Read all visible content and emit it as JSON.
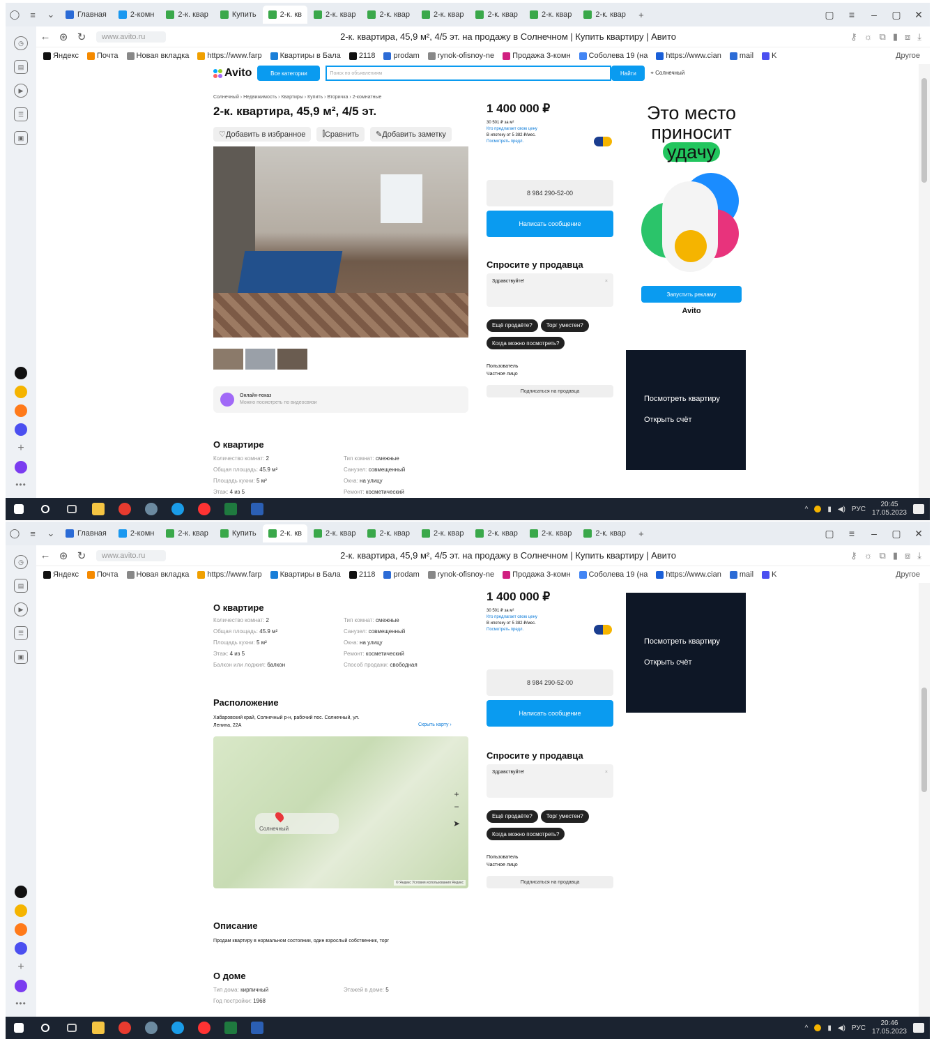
{
  "browser": {
    "tabs": [
      {
        "label": "Главная",
        "color": "#2b6bd6"
      },
      {
        "label": "2-комн",
        "color": "#1a98f0"
      },
      {
        "label": "2-к. квар",
        "color": "#3aa84a"
      },
      {
        "label": "Купить",
        "color": "#3aa84a"
      },
      {
        "label": "2-к. кв",
        "color": "#3aa84a"
      },
      {
        "label": "2-к. квар",
        "color": "#3aa84a"
      },
      {
        "label": "2-к. квар",
        "color": "#3aa84a"
      },
      {
        "label": "2-к. квар",
        "color": "#3aa84a"
      },
      {
        "label": "2-к. квар",
        "color": "#3aa84a"
      },
      {
        "label": "2-к. квар",
        "color": "#3aa84a"
      },
      {
        "label": "2-к. квар",
        "color": "#3aa84a"
      }
    ],
    "active_tab": 4,
    "url": "www.avito.ru",
    "page_title": "2-к. квартира, 45,9 м², 4/5 эт. на продажу в Солнечном | Купить квартиру | Авито",
    "bookmarks": [
      "Яндекс",
      "Почта",
      "Новая вкладка",
      "https://www.farp",
      "Квартиры в Бала",
      "2118",
      "prodam",
      "rynok-ofisnoy-ne",
      "Продажа 3-комн",
      "Соболева 19 (на",
      "https://www.cian",
      "mail",
      "K"
    ],
    "bookmarks_other": "Другое"
  },
  "avito": {
    "logo": "Avito",
    "all_categories": "Все категории",
    "search_placeholder": "Поиск по объявлениям",
    "search_button": "Найти",
    "city": "Солнечный",
    "breadcrumb": "Солнечный › Недвижимость › Квартиры › Купить › Вторичка › 2-комнатные",
    "listing_title": "2-к. квартира, 45,9 м², 4/5 эт.",
    "actions": [
      "Добавить в избранное",
      "Сравнить",
      "Добавить заметку"
    ],
    "online_show_title": "Онлайн-показ",
    "online_show_sub": "Можно посмотреть по видеосвязи",
    "price": "1 400 000 ₽",
    "price_per_m2": "30 501 ₽ за м²",
    "price_history": "Кто предлагает свою цену",
    "mortgage": "В ипотеку от 5 382 ₽/мес.",
    "mortgage_link": "Посмотреть предл.",
    "phone": "8 984 290-52-00",
    "write_button": "Написать сообщение",
    "ask_title": "Спросите у продавца",
    "ask_placeholder": "Здравствуйте!",
    "quick_questions": [
      "Ещё продаёте?",
      "Торг уместен?",
      "Когда можно посмотреть?"
    ],
    "seller_role": "Пользователь",
    "seller_type": "Частное лицо",
    "subscribe": "Подписаться на продавца",
    "ad_text_1": "Это место",
    "ad_text_2": "приносит",
    "ad_text_3": "удачу",
    "ad_button": "Запустить рекламу",
    "ad_logo": "Avito",
    "video_label_1": "Посмотреть квартиру",
    "video_label_2": "Открыть счёт",
    "about_flat_title": "О квартире",
    "about_flat": [
      {
        "k": "Количество комнат:",
        "v": "2"
      },
      {
        "k": "Общая площадь:",
        "v": "45.9 м²"
      },
      {
        "k": "Площадь кухни:",
        "v": "5 м²"
      },
      {
        "k": "Этаж:",
        "v": "4 из 5"
      },
      {
        "k": "Балкон или лоджия:",
        "v": "балкон"
      }
    ],
    "about_flat_right": [
      {
        "k": "Тип комнат:",
        "v": "смежные"
      },
      {
        "k": "Санузел:",
        "v": "совмещенный"
      },
      {
        "k": "Окна:",
        "v": "на улицу"
      },
      {
        "k": "Ремонт:",
        "v": "косметический"
      },
      {
        "k": "Способ продажи:",
        "v": "свободная"
      }
    ],
    "location_title": "Расположение",
    "address_line1": "Хабаровский край, Солнечный р-н, рабочий пос. Солнечный, ул.",
    "address_line2": "Ленина, 22А",
    "show_map": "Скрыть карту",
    "map_place": "Солнечный",
    "map_credit": "© Яндекс Условия использования  Яндекс",
    "description_title": "Описание",
    "description": "Продам квартиру в нормальном состоянии, один взрослый собственник, торг",
    "house_title": "О доме",
    "house": [
      {
        "k": "Тип дома:",
        "v": "кирпичный"
      },
      {
        "k": "Год постройки:",
        "v": "1968"
      }
    ],
    "house_right": [
      {
        "k": "Этажей в доме:",
        "v": "5"
      }
    ]
  },
  "taskbar": {
    "lang": "РУС",
    "time1": "20:45",
    "date1": "17.05.2023",
    "time2": "20:46",
    "date2": "17.05.2023"
  }
}
